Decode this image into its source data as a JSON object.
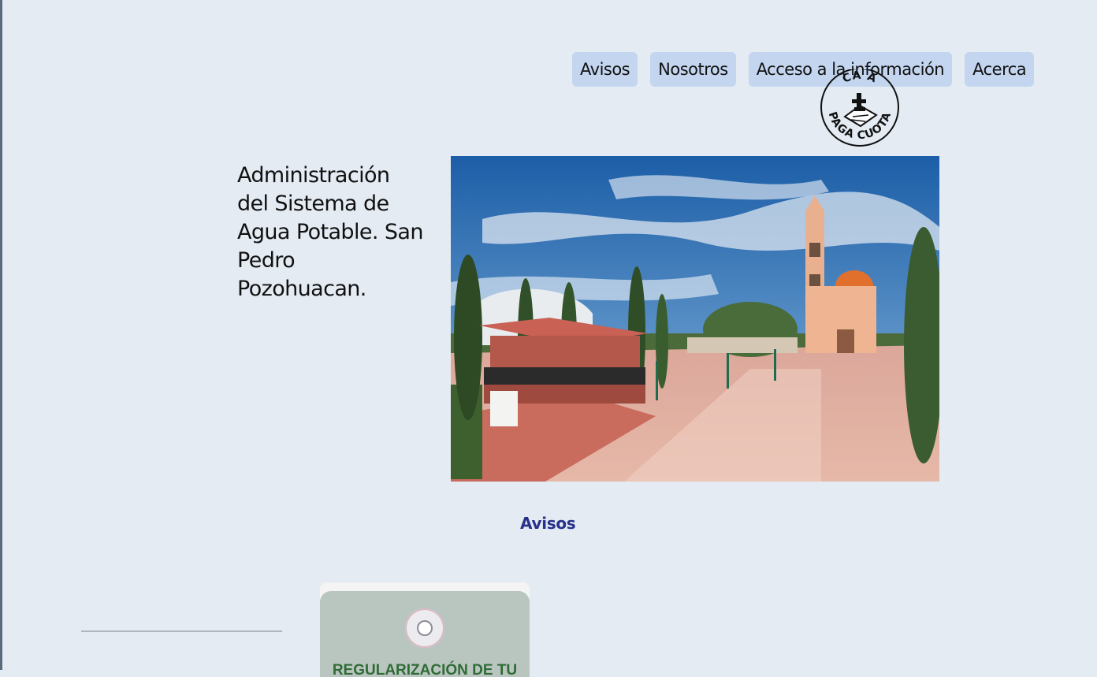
{
  "nav": {
    "items": [
      {
        "label": "Avisos"
      },
      {
        "label": "Nosotros"
      },
      {
        "label": "Acceso a la información"
      },
      {
        "label": "Acerca"
      }
    ]
  },
  "logo": {
    "seal_text_bottom": "PAGA CUOTA",
    "seal_text_top": "CA A"
  },
  "hero": {
    "title": "Administración del Sistema de Agua Potable. San Pedro Pozohuacan.",
    "image_icon": "town-square-photo"
  },
  "avisos": {
    "heading": "Avisos",
    "card": {
      "text": "REGULARIZACIÓN DE TU"
    }
  },
  "colors": {
    "background": "#e4ebf3",
    "nav_button": "#c3d5ef",
    "heading": "#27318a",
    "card_text": "#2f6b35"
  }
}
